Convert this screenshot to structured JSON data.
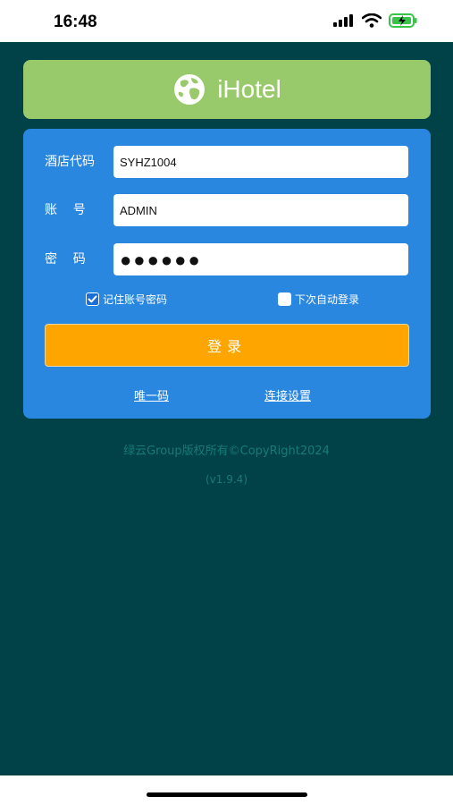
{
  "status_bar": {
    "time": "16:48"
  },
  "header": {
    "app_title": "iHotel"
  },
  "form": {
    "hotel_code_label": "酒店代码",
    "hotel_code_value": "SYHZ1004",
    "account_label": "账    号",
    "account_value": "ADMIN",
    "password_label": "密    码",
    "password_value": "●●●●●●",
    "remember_label": "记住账号密码",
    "remember_checked": true,
    "auto_login_label": "下次自动登录",
    "auto_login_checked": false,
    "login_button": "登录",
    "unique_code_link": "唯一码",
    "connection_settings_link": "连接设置"
  },
  "footer": {
    "copyright": "绿云Group版权所有©CopyRight2024",
    "version": "(v1.9.4)"
  },
  "colors": {
    "background": "#004248",
    "banner": "#98c96a",
    "card": "#2a87e0",
    "button": "#ffa500",
    "footer_text": "#177a78"
  }
}
